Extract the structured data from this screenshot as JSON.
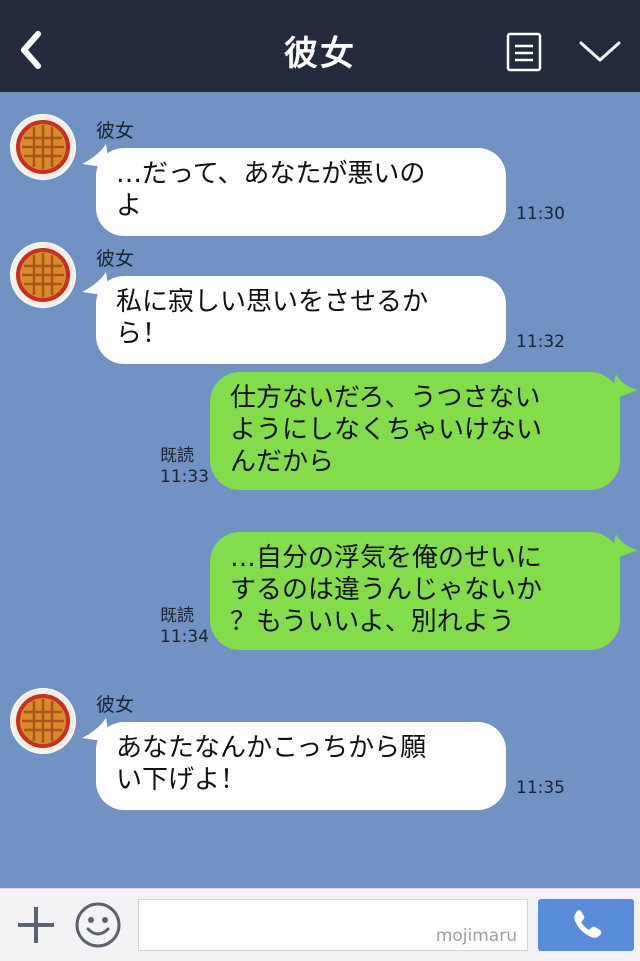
{
  "header": {
    "title": "彼女",
    "back_icon": "chevron-left-icon",
    "menu_icon": "menu-list-icon",
    "more_icon": "chevron-down-icon"
  },
  "messages": [
    {
      "side": "in",
      "sender": "彼女",
      "lines": [
        "…だって、あなたが悪いの",
        "よ"
      ],
      "time": "11:30"
    },
    {
      "side": "in",
      "sender": "彼女",
      "lines": [
        "私に寂しい思いをさせるか",
        "ら！"
      ],
      "time": "11:32"
    },
    {
      "side": "out",
      "read": "既読",
      "lines": [
        "仕方ないだろ、うつさない",
        "ようにしなくちゃいけない",
        "んだから"
      ],
      "time": "11:33"
    },
    {
      "side": "out",
      "read": "既読",
      "lines": [
        "…自分の浮気を俺のせいに",
        "するのは違うんじゃないか",
        "？もういいよ、別れよう"
      ],
      "time": "11:34"
    },
    {
      "side": "in",
      "sender": "彼女",
      "lines": [
        "あなたなんかこっちから願",
        "い下げよ！"
      ],
      "time": "11:35"
    }
  ],
  "footer": {
    "input_value": "",
    "watermark": "mojimaru",
    "plus_icon": "plus-icon",
    "emoji_icon": "smiley-icon",
    "call_icon": "phone-icon"
  },
  "colors": {
    "header_bg": "#232b3d",
    "chat_bg": "#7093c4",
    "incoming_bubble": "#ffffff",
    "outgoing_bubble": "#83dd4b",
    "call_button": "#5a8cdc"
  }
}
